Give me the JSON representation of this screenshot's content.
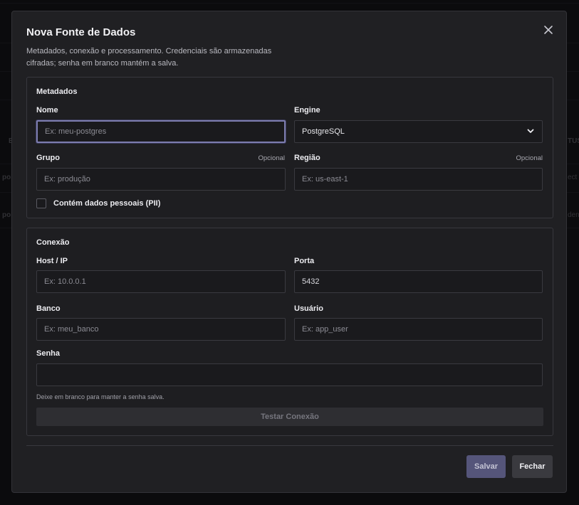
{
  "background": {
    "row_fragments": [
      "po",
      "po"
    ],
    "right_fragments": [
      "TUS",
      "ect",
      "den"
    ],
    "left_col_fragment": "E"
  },
  "modal": {
    "title": "Nova Fonte de Dados",
    "subtitle": "Metadados, conexão e processamento. Credenciais são armazenadas cifradas; senha em branco mantém a salva."
  },
  "metadata": {
    "section_title": "Metadados",
    "name": {
      "label": "Nome",
      "placeholder": "Ex: meu-postgres",
      "value": ""
    },
    "engine": {
      "label": "Engine",
      "value": "PostgreSQL"
    },
    "group": {
      "label": "Grupo",
      "optional": "Opcional",
      "placeholder": "Ex: produção",
      "value": ""
    },
    "region": {
      "label": "Região",
      "optional": "Opcional",
      "placeholder": "Ex: us-east-1",
      "value": ""
    },
    "pii": {
      "label": "Contém dados pessoais (PII)",
      "checked": false
    }
  },
  "connection": {
    "section_title": "Conexão",
    "host": {
      "label": "Host / IP",
      "placeholder": "Ex: 10.0.0.1",
      "value": ""
    },
    "port": {
      "label": "Porta",
      "value": "5432"
    },
    "database": {
      "label": "Banco",
      "placeholder": "Ex: meu_banco",
      "value": ""
    },
    "user": {
      "label": "Usuário",
      "placeholder": "Ex: app_user",
      "value": ""
    },
    "password": {
      "label": "Senha",
      "value": "",
      "hint": "Deixe em branco para manter a senha salva."
    },
    "test_button": "Testar Conexão"
  },
  "footer": {
    "save_label": "Salvar",
    "close_label": "Fechar"
  },
  "colors": {
    "accent": "#55557a",
    "focus_border": "#7d7daf",
    "modal_bg": "#202023"
  }
}
